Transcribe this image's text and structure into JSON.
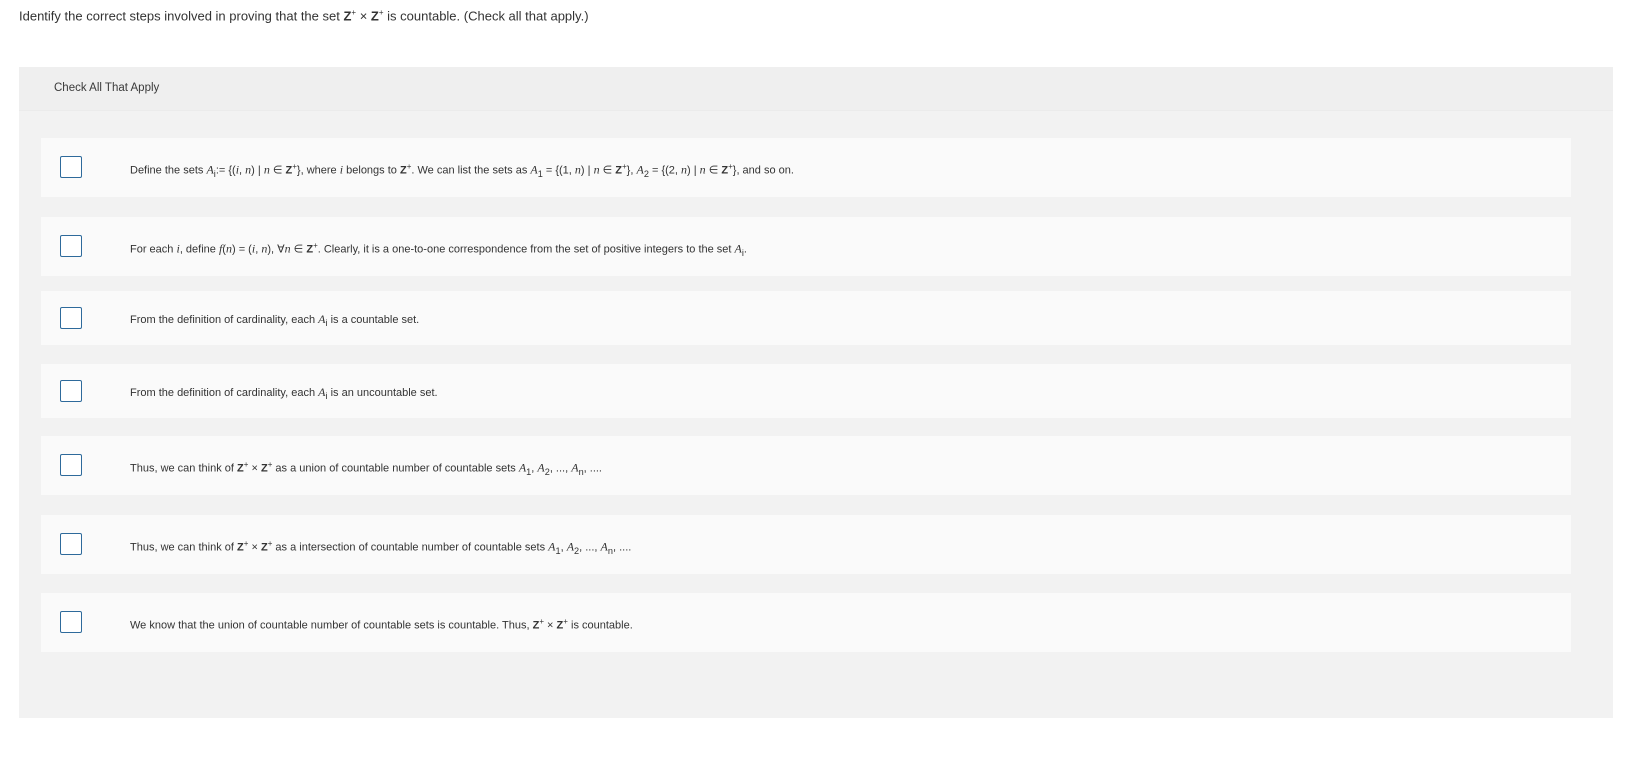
{
  "question": {
    "prefix": "Identify the correct steps involved in proving that the set ",
    "z1": "Z",
    "sup1": "+",
    "times": " × ",
    "z2": "Z",
    "sup2": "+",
    "suffix": " is countable. (Check all that apply.)"
  },
  "panel": {
    "header": "Check All That Apply"
  },
  "options": [
    {
      "p1": "Define the sets ",
      "ai": "A",
      "ai_sub": "i",
      "p2": ":= {(",
      "i": "i",
      "p3": ", ",
      "n": "n",
      "p4": ") | ",
      "n2": "n",
      "p5": " ∈ ",
      "z": "Z",
      "zsup": "+",
      "p6": "}, where ",
      "i2": "i",
      "p7": " belongs to ",
      "z2": "Z",
      "zsup2": "+",
      "p8": ". We can list the sets as ",
      "a1": "A",
      "a1_sub": "1",
      "p9": " = {(1, ",
      "n3": "n",
      "p10": ") | ",
      "n4": "n",
      "p11": " ∈ ",
      "z3": "Z",
      "zsup3": "+",
      "p12": "}, ",
      "a2": "A",
      "a2_sub": "2",
      "p13": " = {(2, ",
      "n5": "n",
      "p14": ") | ",
      "n6": "n",
      "p15": " ∈ ",
      "z4": "Z",
      "zsup4": "+",
      "p16": "}, and so on."
    },
    {
      "p1": "For each ",
      "i": "i",
      "p2": ", define ",
      "f": "f",
      "p3": "(",
      "n": "n",
      "p4": ") = (",
      "i2": "i",
      "p5": ", ",
      "n2": "n",
      "p6": "), ∀",
      "n3": "n",
      "p7": " ∈ ",
      "z": "Z",
      "zsup": "+",
      "p8": ". Clearly, it is a one-to-one correspondence from the set of positive integers to the set ",
      "ai": "A",
      "ai_sub": "i",
      "p9": "."
    },
    {
      "p1": "From the definition of cardinality, each ",
      "ai": "A",
      "ai_sub": "i",
      "p2": " is a countable set."
    },
    {
      "p1": "From the definition of cardinality, each ",
      "ai": "A",
      "ai_sub": "i",
      "p2": " is an uncountable set."
    },
    {
      "p1": "Thus, we can think of ",
      "z1": "Z",
      "sup1": "+",
      "times": " × ",
      "z2": "Z",
      "sup2": "+",
      "p2": " as a union of countable number of countable sets ",
      "a1": "A",
      "a1_sub": "1",
      "p3": ", ",
      "a2": "A",
      "a2_sub": "2",
      "p4": ", ..., ",
      "an": "A",
      "an_sub": "n",
      "p5": ", ...."
    },
    {
      "p1": "Thus, we can think of ",
      "z1": "Z",
      "sup1": "+",
      "times": " × ",
      "z2": "Z",
      "sup2": "+",
      "p2": " as a intersection of countable number of countable sets ",
      "a1": "A",
      "a1_sub": "1",
      "p3": ", ",
      "a2": "A",
      "a2_sub": "2",
      "p4": ", ..., ",
      "an": "A",
      "an_sub": "n",
      "p5": ", ...."
    },
    {
      "p1": "We know that the union of countable number of countable sets is countable. Thus, ",
      "z1": "Z",
      "sup1": "+",
      "times": " × ",
      "z2": "Z",
      "sup2": "+",
      "p2": " is countable."
    }
  ]
}
